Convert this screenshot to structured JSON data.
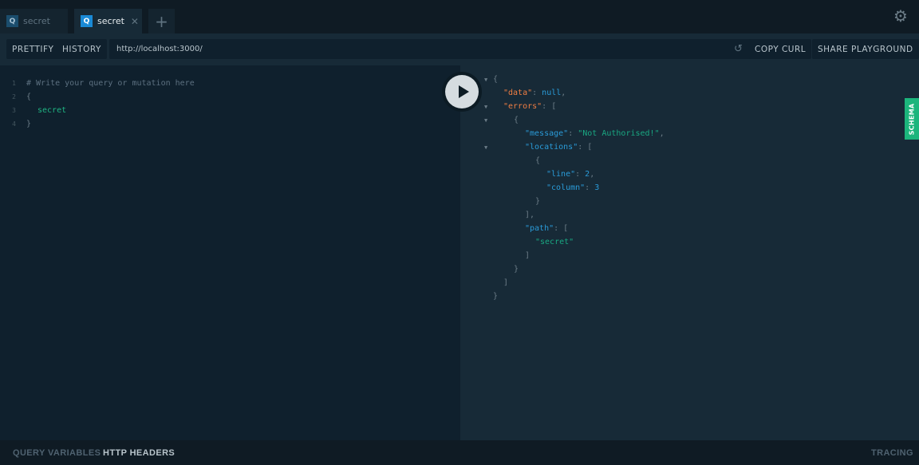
{
  "tabs": [
    {
      "icon": "Q",
      "label": "secret",
      "active": false
    },
    {
      "icon": "Q",
      "label": "secret",
      "active": true,
      "close": "✕"
    }
  ],
  "add_tab": "+",
  "toolbar": {
    "prettify": "PRETTIFY",
    "history": "HISTORY",
    "url": "http://localhost:3000/",
    "copy_curl": "COPY CURL",
    "share": "SHARE PLAYGROUND"
  },
  "editor": {
    "lines": [
      {
        "n": "1",
        "text": "# Write your query or mutation here"
      },
      {
        "n": "2",
        "text": "{"
      },
      {
        "n": "3",
        "text": "secret"
      },
      {
        "n": "4",
        "text": "}"
      }
    ]
  },
  "result": {
    "data_key": "\"data\"",
    "data_val": "null",
    "errors_key": "\"errors\"",
    "message_key": "\"message\"",
    "message_val": "\"Not Authorised!\"",
    "locations_key": "\"locations\"",
    "line_key": "\"line\"",
    "line_val": "2",
    "column_key": "\"column\"",
    "column_val": "3",
    "path_key": "\"path\"",
    "path_val": "\"secret\""
  },
  "schema_label": "SCHEMA",
  "bottom": {
    "query_variables": "QUERY VARIABLES",
    "http_headers": "HTTP HEADERS",
    "tracing": "TRACING"
  },
  "colors": {
    "accent_green": "#1cb57c",
    "tab_icon_active": "#1a8ad6"
  }
}
